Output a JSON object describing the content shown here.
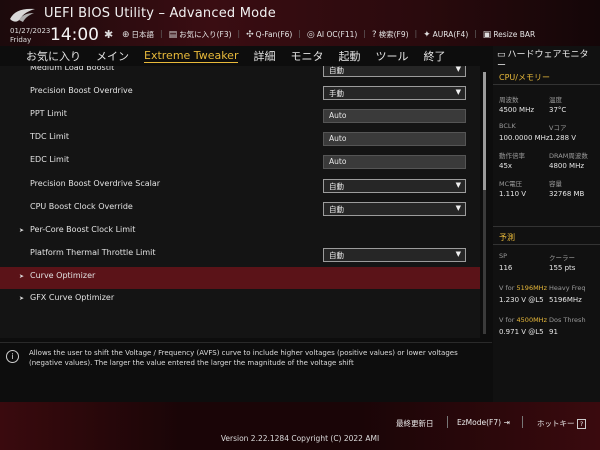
{
  "header": {
    "title": "UEFI BIOS Utility – Advanced Mode",
    "date": "01/27/2023",
    "day": "Friday",
    "time": "14:00",
    "items": [
      {
        "icon": "globe-icon",
        "glyph": "⊕",
        "label": "日本語"
      },
      {
        "icon": "star-icon",
        "glyph": "▤",
        "label": "お気に入り(F3)"
      },
      {
        "icon": "fan-icon",
        "glyph": "✣",
        "label": "Q-Fan(F6)"
      },
      {
        "icon": "ai-oc-icon",
        "glyph": "◎",
        "label": "AI OC(F11)"
      },
      {
        "icon": "search-icon",
        "glyph": "?",
        "label": "検索(F9)"
      },
      {
        "icon": "aura-icon",
        "glyph": "✦",
        "label": "AURA(F4)"
      },
      {
        "icon": "resize-bar-icon",
        "glyph": "▣",
        "label": "Resize BAR"
      }
    ]
  },
  "tabs": [
    "お気に入り",
    "メイン",
    "Extreme Tweaker",
    "詳細",
    "モニタ",
    "起動",
    "ツール",
    "終了"
  ],
  "active_tab": "Extreme Tweaker",
  "settings": [
    {
      "label": "Medium Load Boostit",
      "type": "select",
      "value": "自動"
    },
    {
      "label": "Precision Boost Overdrive",
      "type": "select",
      "value": "手動"
    },
    {
      "label": "PPT Limit",
      "type": "text",
      "value": "Auto"
    },
    {
      "label": "TDC Limit",
      "type": "text",
      "value": "Auto"
    },
    {
      "label": "EDC Limit",
      "type": "text",
      "value": "Auto"
    },
    {
      "label": "Precision Boost Overdrive Scalar",
      "type": "select",
      "value": "自動"
    },
    {
      "label": "CPU Boost Clock Override",
      "type": "select",
      "value": "自動"
    },
    {
      "label": "Per-Core Boost Clock Limit",
      "type": "submenu",
      "value": ""
    },
    {
      "label": "Platform Thermal Throttle Limit",
      "type": "select",
      "value": "自動"
    },
    {
      "label": "Curve Optimizer",
      "type": "submenu",
      "value": "",
      "highlighted": true
    },
    {
      "label": "GFX Curve Optimizer",
      "type": "submenu",
      "value": ""
    }
  ],
  "info_text": "Allows the user to shift the Voltage / Frequency (AVFS) curve to include higher voltages (positive values) or lower voltages (negative values). The larger the value entered the larger the magnitude of the voltage shift",
  "hw_monitor": {
    "title": "ハードウェアモニター",
    "cpu_section": "CPU/メモリー",
    "cpu": [
      {
        "label": "周波数",
        "value": "4500 MHz"
      },
      {
        "label": "温度",
        "value": "37°C"
      },
      {
        "label": "BCLK",
        "value": "100.0000 MHz"
      },
      {
        "label": "Vコア",
        "value": "1.288 V"
      },
      {
        "label": "動作倍率",
        "value": "45x"
      },
      {
        "label": "DRAM周波数",
        "value": "4800 MHz"
      },
      {
        "label": "MC電圧",
        "value": "1.110 V"
      },
      {
        "label": "容量",
        "value": "32768 MB"
      }
    ],
    "predict_section": "予測",
    "predict": [
      {
        "label": "SP",
        "value": "116"
      },
      {
        "label": "クーラー",
        "value": "155 pts"
      },
      {
        "label_prefix": "V for ",
        "label_hi": "5196MHz",
        "value": "1.230 V @L5"
      },
      {
        "label": "Heavy Freq",
        "value": "5196MHz"
      },
      {
        "label_prefix": "V for ",
        "label_hi": "4500MHz",
        "value": "0.971 V @L5"
      },
      {
        "label": "Dos Thresh",
        "value": "91"
      }
    ]
  },
  "footer": {
    "last_modified": "最終更新日",
    "ezmode": "EzMode(F7)",
    "hotkeys": "ホットキー",
    "hotkey_glyph": "?",
    "version": "Version 2.22.1284 Copyright (C) 2022 AMI"
  }
}
